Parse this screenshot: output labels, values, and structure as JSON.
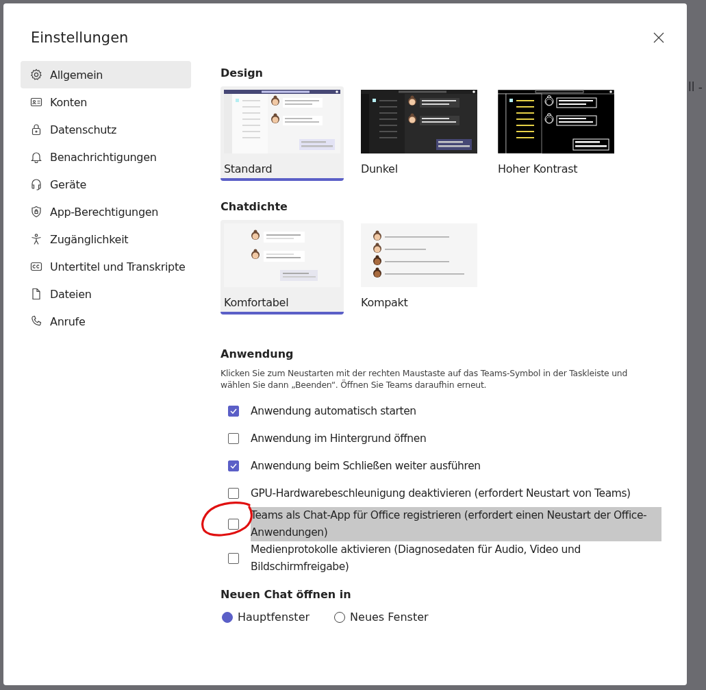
{
  "background_text": "ll -",
  "dialog": {
    "title": "Einstellungen"
  },
  "sidebar": {
    "items": [
      {
        "label": "Allgemein",
        "selected": true
      },
      {
        "label": "Konten",
        "selected": false
      },
      {
        "label": "Datenschutz",
        "selected": false
      },
      {
        "label": "Benachrichtigungen",
        "selected": false
      },
      {
        "label": "Geräte",
        "selected": false
      },
      {
        "label": "App-Berechtigungen",
        "selected": false
      },
      {
        "label": "Zugänglichkeit",
        "selected": false
      },
      {
        "label": "Untertitel und Transkripte",
        "selected": false
      },
      {
        "label": "Dateien",
        "selected": false
      },
      {
        "label": "Anrufe",
        "selected": false
      }
    ]
  },
  "design": {
    "heading": "Design",
    "options": [
      {
        "label": "Standard",
        "kind": "standard",
        "selected": true
      },
      {
        "label": "Dunkel",
        "kind": "dark",
        "selected": false
      },
      {
        "label": "Hoher Kontrast",
        "kind": "contrast",
        "selected": false
      }
    ]
  },
  "density": {
    "heading": "Chatdichte",
    "options": [
      {
        "label": "Komfortabel",
        "kind": "comfortable",
        "selected": true
      },
      {
        "label": "Kompakt",
        "kind": "compact",
        "selected": false
      }
    ]
  },
  "application": {
    "heading": "Anwendung",
    "note": "Klicken Sie zum Neustarten mit der rechten Maustaste auf das Teams-Symbol in der Taskleiste und wählen Sie dann „Beenden“. Öffnen Sie Teams daraufhin erneut.",
    "options": [
      {
        "label": "Anwendung automatisch starten",
        "checked": true,
        "highlighted": false,
        "circled": false
      },
      {
        "label": "Anwendung im Hintergrund öffnen",
        "checked": false,
        "highlighted": false,
        "circled": false
      },
      {
        "label": "Anwendung beim Schließen weiter ausführen",
        "checked": true,
        "highlighted": false,
        "circled": false
      },
      {
        "label": "GPU-Hardwarebeschleunigung deaktivieren (erfordert Neustart von Teams)",
        "checked": false,
        "highlighted": false,
        "circled": false
      },
      {
        "label": "Teams als Chat-App für Office registrieren (erfordert einen Neustart der Office-Anwendungen)",
        "checked": false,
        "highlighted": true,
        "circled": true
      },
      {
        "label": "Medienprotokolle aktivieren (Diagnosedaten für Audio, Video und Bildschirmfreigabe)",
        "checked": false,
        "highlighted": false,
        "circled": false
      }
    ]
  },
  "new_chat": {
    "heading": "Neuen Chat öffnen in",
    "options": [
      {
        "label": "Hauptfenster",
        "selected": true
      },
      {
        "label": "Neues Fenster",
        "selected": false
      }
    ]
  }
}
